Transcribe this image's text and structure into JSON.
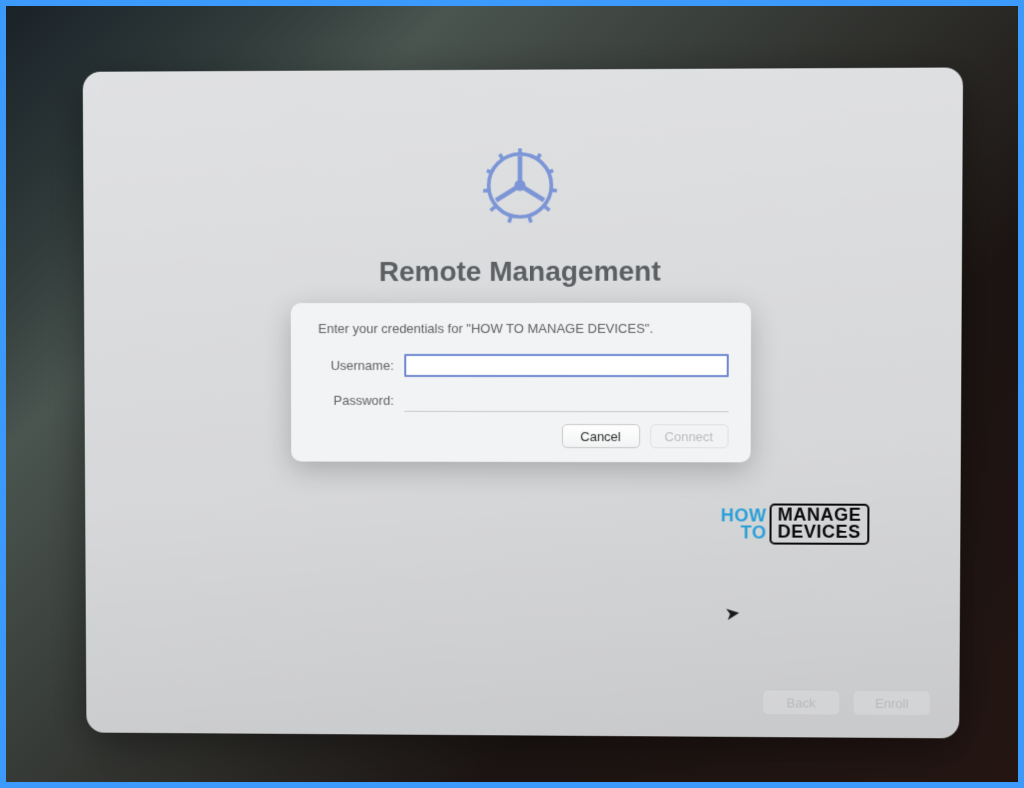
{
  "window": {
    "title": "Remote Management"
  },
  "dialog": {
    "prompt": "Enter your credentials for \"HOW TO MANAGE DEVICES\".",
    "username_label": "Username:",
    "password_label": "Password:",
    "username_value": "",
    "password_value": "",
    "cancel_label": "Cancel",
    "connect_label": "Connect"
  },
  "footer": {
    "back_label": "Back",
    "enroll_label": "Enroll"
  },
  "watermark": {
    "left_top": "HOW",
    "left_bottom": "TO",
    "right_top": "MANAGE",
    "right_bottom": "DEVICES"
  },
  "icons": {
    "gear": "gear-icon"
  }
}
